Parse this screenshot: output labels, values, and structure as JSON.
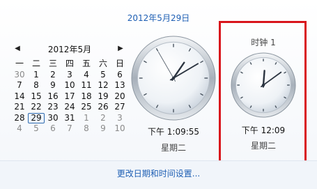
{
  "header": {
    "date_title": "2012年5月29日"
  },
  "calendar": {
    "month_label": "2012年5月",
    "prev_icon": "◀",
    "next_icon": "▶",
    "weekdays": [
      "一",
      "二",
      "三",
      "四",
      "五",
      "六",
      "日"
    ],
    "weeks": [
      [
        "30",
        "1",
        "2",
        "3",
        "4",
        "5",
        "6"
      ],
      [
        "7",
        "8",
        "9",
        "10",
        "11",
        "12",
        "13"
      ],
      [
        "14",
        "15",
        "16",
        "17",
        "18",
        "19",
        "20"
      ],
      [
        "21",
        "22",
        "23",
        "24",
        "25",
        "26",
        "27"
      ],
      [
        "28",
        "29",
        "30",
        "31",
        "1",
        "2",
        "3"
      ],
      [
        "4",
        "5",
        "6",
        "7",
        "8",
        "9",
        "10"
      ]
    ],
    "today": "29"
  },
  "clock_main": {
    "time": "下午 1:09:55",
    "weekday": "星期二",
    "hour": 1,
    "minute": 9,
    "second": 55
  },
  "clock_second": {
    "title": "时钟 1",
    "time": "下午 12:09",
    "weekday": "星期二",
    "hour": 12,
    "minute": 9
  },
  "footer": {
    "settings_link": "更改日期和时间设置..."
  },
  "colors": {
    "accent_link": "#1e5fb4",
    "highlight_frame": "#d9151c"
  }
}
